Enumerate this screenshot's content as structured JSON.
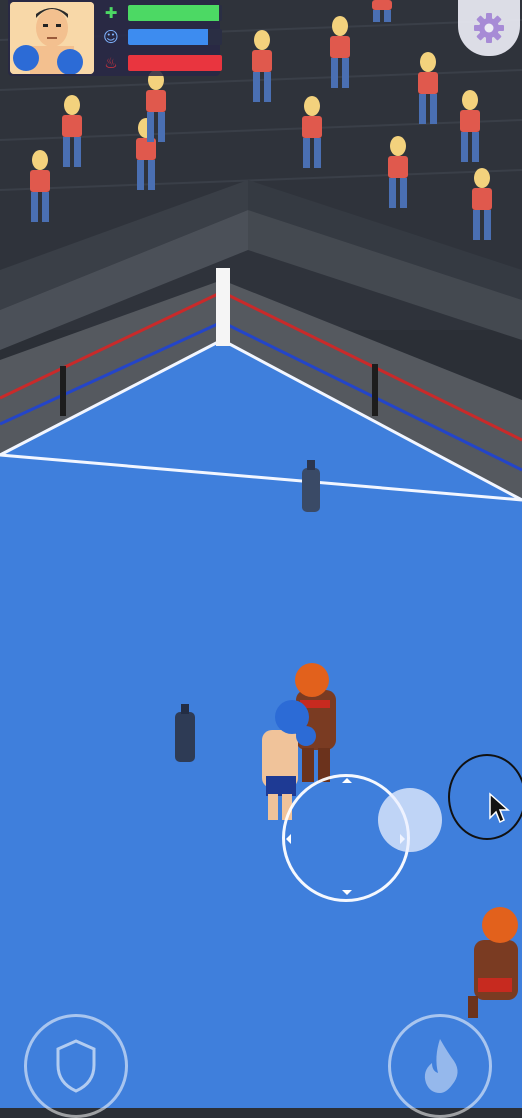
{
  "hud": {
    "player_portrait": "boxer-portrait",
    "stats": [
      {
        "icon": "health-plus-icon",
        "color": "#4cd964",
        "level": 0.97
      },
      {
        "icon": "stamina-face-icon",
        "color": "#3d8cf0",
        "level": 0.85
      },
      {
        "icon": "fire-power-icon",
        "color": "#e9353f",
        "level": 1.0
      }
    ]
  },
  "settings": {
    "icon": "gear-icon"
  },
  "controls": {
    "joystick": {
      "icon": "joystick"
    },
    "shield_button": {
      "icon": "shield-icon"
    },
    "fire_button": {
      "icon": "fire-icon"
    }
  },
  "colors": {
    "ring_canvas": "#3f7fdc",
    "ring_rope_red": "#c92a2a",
    "ring_rope_blue": "#2445c8",
    "crowd_shirt": "#e0594d",
    "player_glove": "#2c6bd6",
    "opponent_skin": "#7a3b22"
  }
}
